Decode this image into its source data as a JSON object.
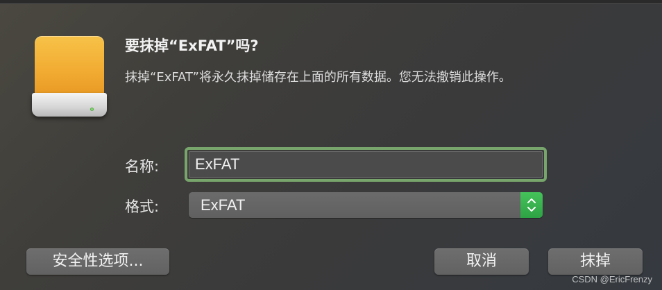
{
  "dialog": {
    "title": "要抹掉“ExFAT”吗?",
    "message": "抹掉“ExFAT”将永久抹掉储存在上面的所有数据。您无法撤销此操作。"
  },
  "form": {
    "name_label": "名称:",
    "name_value": "ExFAT",
    "format_label": "格式:",
    "format_value": "ExFAT"
  },
  "buttons": {
    "security_options": "安全性选项...",
    "cancel": "取消",
    "erase": "抹掉"
  },
  "watermark": "CSDN @EricFrenzy",
  "icons": {
    "drive": "external-drive-icon",
    "stepper": "up-down-chevron-icon"
  },
  "colors": {
    "accent_focus": "#77a56b",
    "stepper_green": "#2ea345",
    "drive_orange": "#f2ad34"
  }
}
